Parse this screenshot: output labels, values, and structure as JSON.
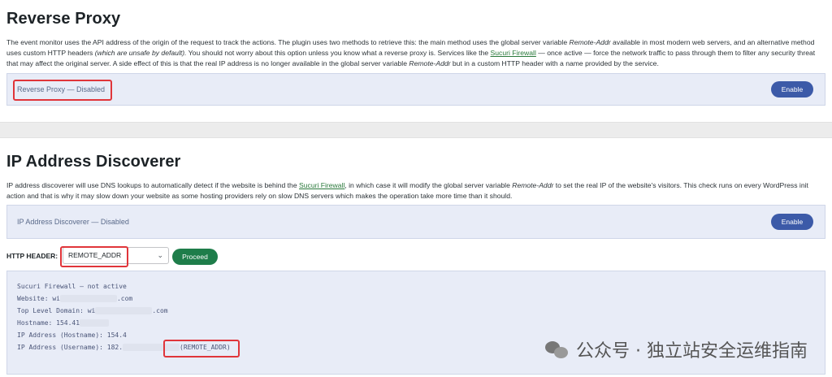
{
  "reverse_proxy": {
    "title": "Reverse Proxy",
    "desc_1": "The event monitor uses the API address of the origin of the request to track the actions. The plugin uses two methods to retrieve this: the main method uses the global server variable ",
    "desc_var_1": "Remote-Addr",
    "desc_2": " available in most modern web servers, and an alternative method uses custom HTTP headers ",
    "desc_em": "(which are unsafe by default).",
    "desc_3": " You should not worry about this option unless you know what a reverse proxy is. Services like the ",
    "desc_link": "Sucuri Firewall",
    "desc_4": " — once active — force the network traffic to pass through them to filter any security threat that may affect the original server. A side effect of this is that the real IP address is no longer available in the global server variable ",
    "desc_var_2": "Remote-Addr",
    "desc_5": " but in a custom HTTP header with a name provided by the service.",
    "status": "Reverse Proxy — Disabled",
    "enable_label": "Enable"
  },
  "ip_discoverer": {
    "title": "IP Address Discoverer",
    "desc_1": "IP address discoverer will use DNS lookups to automatically detect if the website is behind the ",
    "desc_link": "Sucuri Firewall",
    "desc_2": ", in which case it will modify the global server variable ",
    "desc_var": "Remote-Addr",
    "desc_3": " to set the real IP of the website's visitors. This check runs on every WordPress init action and that is why it may slow down your website as some hosting providers rely on slow DNS servers which makes the operation take more time than it should.",
    "status": "IP Address Discoverer — Disabled",
    "enable_label": "Enable",
    "http_header_label": "HTTP HEADER:",
    "http_header_value": "REMOTE_ADDR",
    "proceed_label": "Proceed",
    "info": {
      "firewall": "Sucuri Firewall — not active",
      "website_prefix": "Website: wi",
      "website_suffix": ".com",
      "tld_prefix": "Top Level Domain: wi",
      "tld_suffix": ".com",
      "hostname": "Hostname: 154.41",
      "ip_hostname": "IP Address (Hostname): 154.4",
      "ip_username_prefix": "IP Address (Username): 182.",
      "ip_username_suffix": "(REMOTE_ADDR)"
    }
  },
  "watermark": "公众号 · 独立站安全运维指南",
  "colors": {
    "accent": "#3c5aa8",
    "proceed": "#1e7d4a",
    "highlight": "#e0353a",
    "panel": "#e8ecf7",
    "link": "#2b7a3c"
  }
}
